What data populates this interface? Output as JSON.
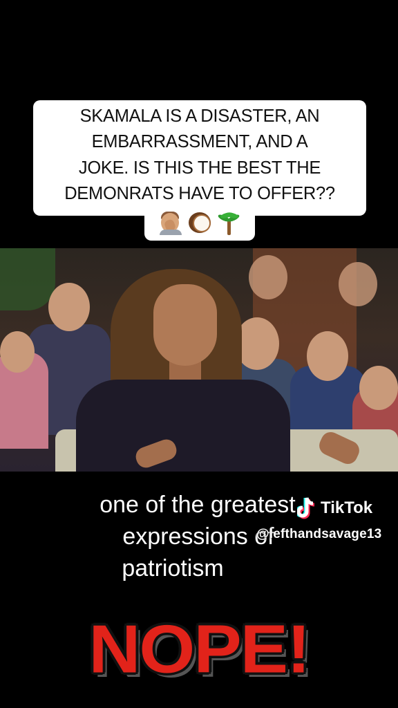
{
  "caption": {
    "lines": [
      "SKAMALA IS A DISASTER, AN",
      "EMBARRASSMENT, AND A",
      "JOKE. IS THIS THE BEST THE",
      "DEMONRATS HAVE TO OFFER??"
    ],
    "emojis": [
      "person-facepalming-icon",
      "coconut-icon",
      "palm-tree-icon"
    ]
  },
  "video": {
    "subtitle_lines": [
      "one of the greatest",
      "expressions of",
      "patriotism"
    ]
  },
  "watermark": {
    "brand": "TikTok",
    "handle": "@lefthandsavage13",
    "logo_icon": "tiktok-note-icon"
  },
  "overlay": {
    "text": "NOPE!"
  },
  "colors": {
    "background": "#000000",
    "caption_bg": "#ffffff",
    "nope_red": "#e2231a"
  }
}
